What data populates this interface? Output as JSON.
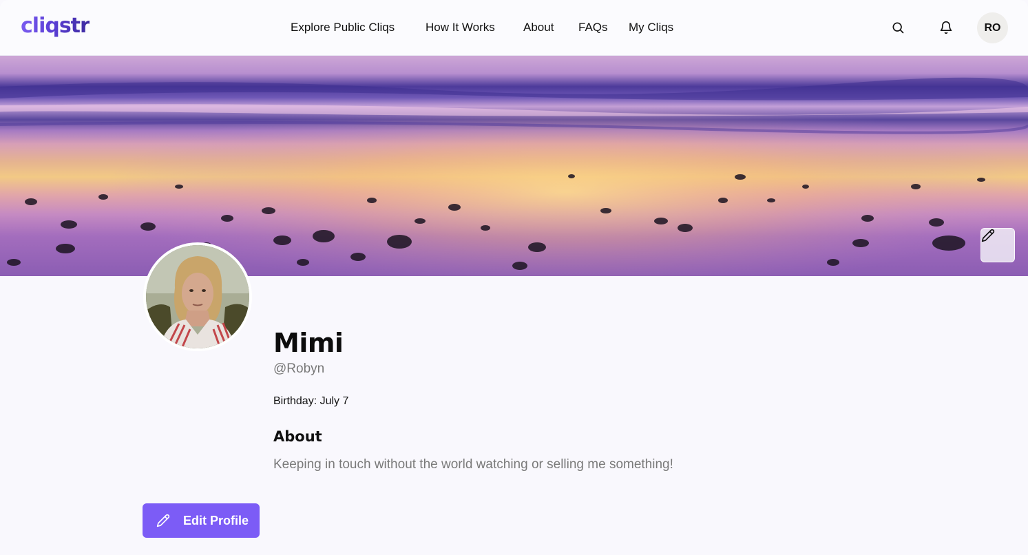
{
  "header": {
    "logo": "cliqstr",
    "nav": {
      "explore": "Explore Public Cliqs",
      "how_it_works": "How It Works",
      "about": "About",
      "faqs": "FAQs",
      "my_cliqs": "My Cliqs"
    },
    "icons": {
      "search": "search-icon",
      "notifications": "bell-icon"
    },
    "user_initials": "RO"
  },
  "cover": {
    "image": "beach-sunset-pebbles-photo",
    "edit_icon": "pencil-icon"
  },
  "profile": {
    "photo": "profile-photo-woman-blonde",
    "display_name": "Mimi",
    "handle": "@Robyn",
    "birthday": "Birthday: July 7",
    "about_heading": "About",
    "bio": "Keeping in touch without the world watching or selling me something!",
    "edit_button_label": "Edit Profile",
    "edit_button_icon": "pencil-icon"
  },
  "colors": {
    "accent": "#7c5cf6",
    "logo_gradient_start": "#7a5cf0",
    "logo_gradient_end": "#3d2aa0",
    "page_background": "#f9f8fd",
    "muted_text": "#777777"
  }
}
